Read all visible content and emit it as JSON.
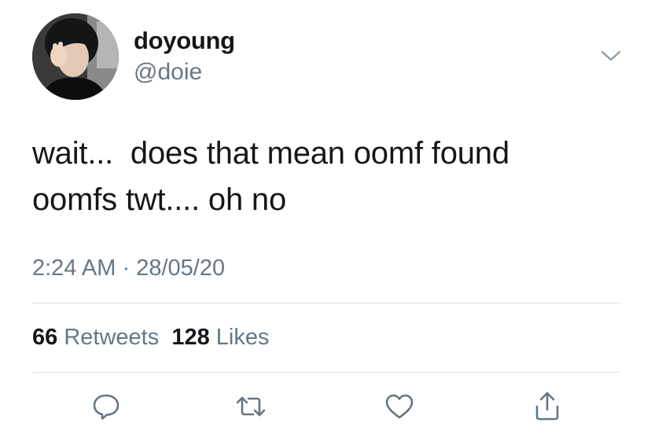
{
  "user": {
    "display_name": "doyoung",
    "handle": "@doie",
    "avatar_icon": "profile-photo"
  },
  "tweet": {
    "lines": [
      "wait...  does that mean oomf found",
      "oomfs twt.... oh no"
    ],
    "time": "2:24 AM",
    "separator": " · ",
    "date": "28/05/20"
  },
  "stats": {
    "retweets_count": "66",
    "retweets_label": "Retweets",
    "likes_count": "128",
    "likes_label": "Likes"
  },
  "actions": [
    {
      "name": "reply-icon"
    },
    {
      "name": "retweet-icon"
    },
    {
      "name": "like-icon"
    },
    {
      "name": "share-icon"
    }
  ],
  "menu": {
    "icon": "chevron-down-icon"
  },
  "colors": {
    "text_primary": "#14171a",
    "text_secondary": "#657786",
    "divider": "#d6dde3",
    "icon": "#657786"
  }
}
